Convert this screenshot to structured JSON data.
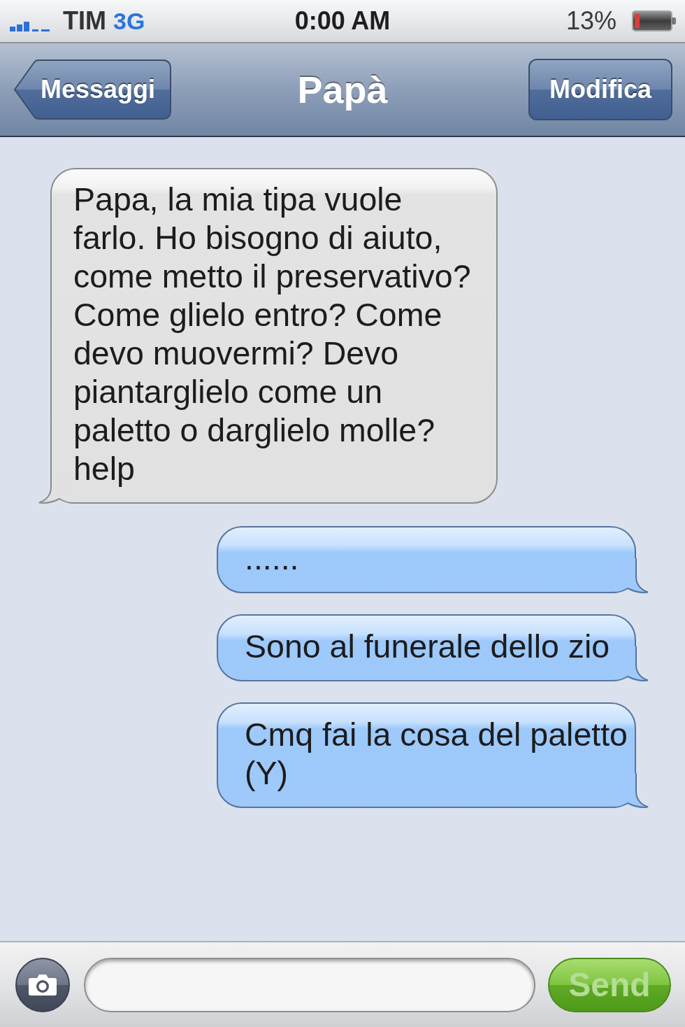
{
  "status_bar": {
    "carrier": "TIM",
    "network": "3G",
    "time": "0:00 AM",
    "battery": "13%"
  },
  "nav_bar": {
    "back_button": "Messaggi",
    "title": "Papà",
    "edit_button": "Modifica"
  },
  "messages": [
    {
      "kind": "received",
      "text": "Papa, la mia tipa vuole farlo. Ho bisogno di aiuto, come metto il preservativo? Come glielo entro? Come devo muovermi? Devo piantarglielo come un paletto o darglielo molle? help"
    },
    {
      "kind": "sent",
      "text": "......"
    },
    {
      "kind": "sent",
      "text": "Sono al funerale dello zio"
    },
    {
      "kind": "sent",
      "text": "Cmq fai la cosa del paletto (Y)"
    }
  ],
  "compose": {
    "send_button": {
      "label": "Send",
      "disabled": true
    }
  }
}
